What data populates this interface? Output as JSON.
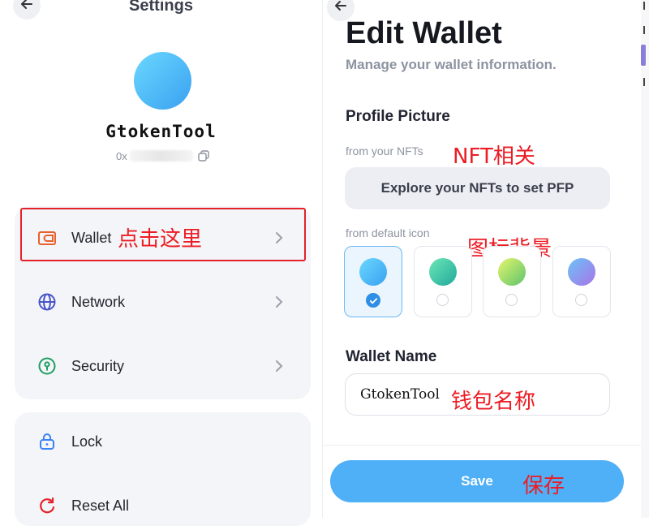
{
  "settings": {
    "title": "Settings",
    "username": "GtokenTool",
    "address_prefix": "0x",
    "menu": [
      {
        "label": "Wallet",
        "icon": "wallet-icon",
        "color": "#e8602c"
      },
      {
        "label": "Network",
        "icon": "globe-icon",
        "color": "#4a55c9"
      },
      {
        "label": "Security",
        "icon": "lock-shield-icon",
        "color": "#1f9d63"
      },
      {
        "label": "Lock",
        "icon": "lock-icon",
        "color": "#3b82f6"
      },
      {
        "label": "Reset All",
        "icon": "reset-icon",
        "color": "#e3222a"
      }
    ],
    "annotation_wallet": "点击这里"
  },
  "edit_wallet": {
    "title": "Edit Wallet",
    "subtitle": "Manage your wallet information.",
    "profile_picture_heading": "Profile Picture",
    "from_nfts_label": "from your NFTs",
    "explore_nfts_button": "Explore your NFTs to set PFP",
    "from_default_label": "from default icon",
    "default_icons": [
      {
        "name": "blue",
        "colors": [
          "#6ad8ff",
          "#3aa0f0"
        ],
        "selected": true
      },
      {
        "name": "green",
        "colors": [
          "#6ee7b7",
          "#1fa89a"
        ],
        "selected": false
      },
      {
        "name": "lime",
        "colors": [
          "#e5f56b",
          "#5dc46f"
        ],
        "selected": false
      },
      {
        "name": "purple",
        "colors": [
          "#6cc3f7",
          "#a873e8"
        ],
        "selected": false
      }
    ],
    "wallet_name_heading": "Wallet Name",
    "wallet_name_value": "GtokenTool",
    "save_button": "Save",
    "annotations": {
      "nft": "NFT相关",
      "icon_bg": "图标背景",
      "wallet_name": "钱包名称",
      "save": "保存"
    }
  },
  "colors": {
    "accent": "#4fb0f7",
    "annotation_red": "#ec1c24"
  }
}
